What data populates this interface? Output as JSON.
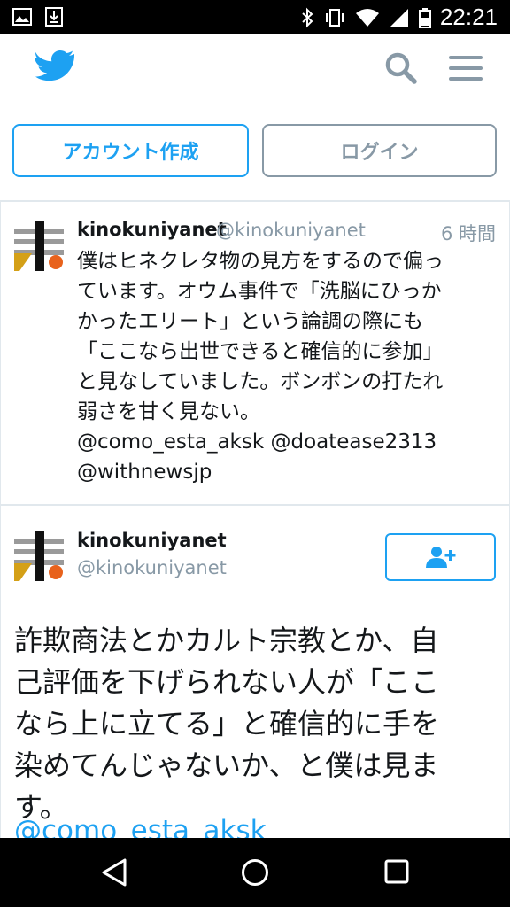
{
  "status_bar": {
    "time": "22:21"
  },
  "header": {
    "logo_icon": "twitter-bird-icon",
    "search_icon": "search-icon",
    "menu_icon": "hamburger-menu-icon"
  },
  "auth": {
    "signup_label": "アカウント作成",
    "login_label": "ログイン"
  },
  "tweets": [
    {
      "name": "kinokuniyanet",
      "handle": "@kinokuniyanet",
      "time": "6 時間",
      "lines": [
        "僕はヒネクレタ物の見方をするので偏っ",
        "ています。オウム事件で「洗脳にひっか",
        "かったエリート」という論調の際にも",
        "「ここなら出世できると確信的に参加」",
        "と見なしていました。ボンボンの打たれ",
        "弱さを甘く見ない。",
        "@como_esta_aksk @doatease2313",
        "@withnewsjp"
      ]
    },
    {
      "name": "kinokuniyanet",
      "handle": "@kinokuniyanet",
      "follow_icon": "add-user-icon",
      "lines": [
        "詐欺商法とかカルト宗教とか、自",
        "己評価を下げられない人が「ここ",
        "なら上に立てる」と確信的に手を",
        "染めてんじゃないか、と僕は見ま",
        "す。"
      ],
      "link": "@como_esta_aksk"
    }
  ],
  "colors": {
    "accent": "#1da1f2",
    "muted": "#8899a6",
    "text": "#14171a"
  }
}
